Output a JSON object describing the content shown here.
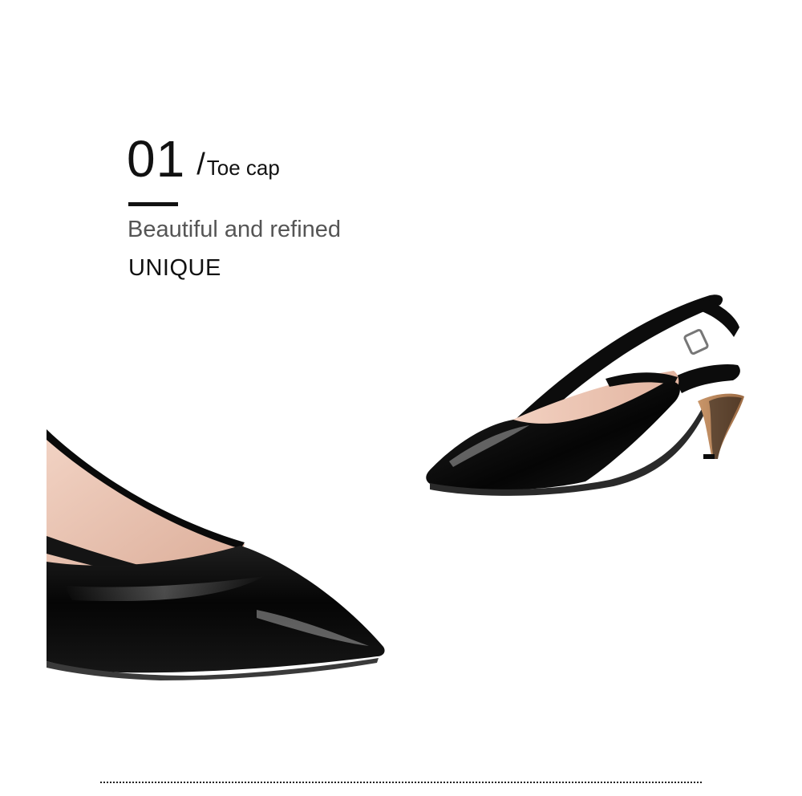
{
  "feature": {
    "number": "01",
    "slash": "/",
    "title": "Toe cap",
    "tagline": "Beautiful and refined",
    "tagword": "UNIQUE"
  },
  "colors": {
    "patent_black": "#0b0b0b",
    "lining_nude": "#e9bfae",
    "heel_tan": "#b88458",
    "text_dark": "#111111",
    "text_grey": "#555555"
  }
}
